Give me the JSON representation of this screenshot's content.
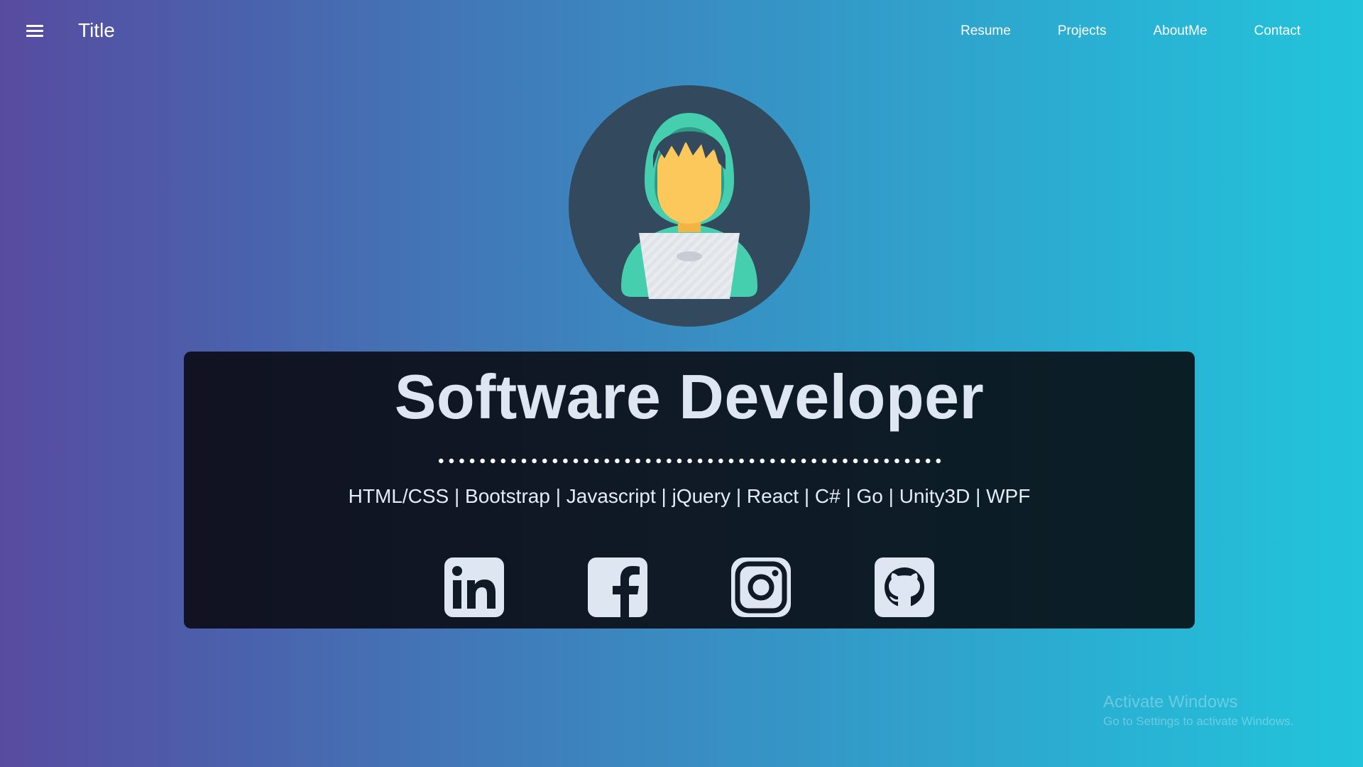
{
  "header": {
    "brand": "Title",
    "nav": [
      "Resume",
      "Projects",
      "AboutMe",
      "Contact"
    ],
    "menu_icon": "hamburger-menu-icon"
  },
  "hero": {
    "avatar_icon": "hooded-developer-laptop-avatar",
    "title": "Software Developer",
    "skills": "HTML/CSS | Bootstrap | Javascript | jQuery | React | C# | Go | Unity3D | WPF",
    "social_icons": [
      "linkedin-icon",
      "facebook-icon",
      "instagram-icon",
      "github-icon"
    ]
  },
  "watermark": {
    "line1": "Activate Windows",
    "line2": "Go to Settings to activate Windows."
  },
  "colors": {
    "gradient_start": "#574b9f",
    "gradient_end": "#22c4db",
    "card_bg": "#0f1a26",
    "title_text": "#dde6f1",
    "avatar_bg": "#32495e",
    "hood": "#46cfae",
    "skin": "#fcc85c",
    "laptop": "#e8ebef"
  }
}
